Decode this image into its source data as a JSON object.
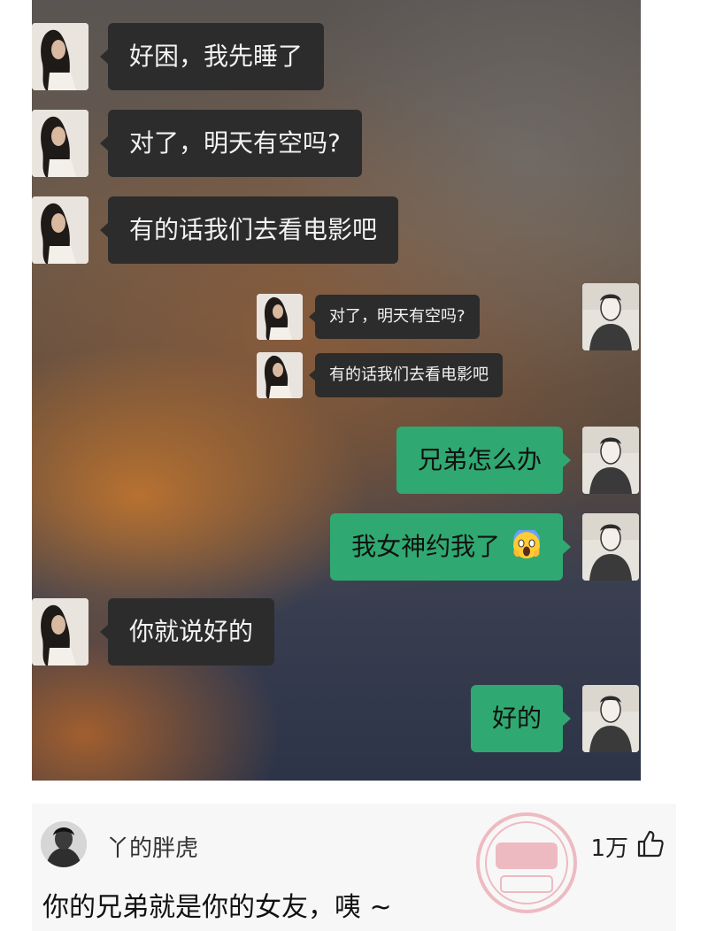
{
  "chat": {
    "messages": [
      {
        "id": "m1",
        "side": "left",
        "size": "big",
        "text": "好困，我先睡了"
      },
      {
        "id": "m2",
        "side": "left",
        "size": "big",
        "text": "对了，明天有空吗?"
      },
      {
        "id": "m3",
        "side": "left",
        "size": "big",
        "text": "有的话我们去看电影吧"
      },
      {
        "id": "m4",
        "side": "left",
        "size": "small",
        "text": "对了，明天有空吗?"
      },
      {
        "id": "m5",
        "side": "left",
        "size": "small",
        "text": "有的话我们去看电影吧"
      },
      {
        "id": "m6",
        "side": "right",
        "size": "big",
        "text": "兄弟怎么办"
      },
      {
        "id": "m7",
        "side": "right",
        "size": "big",
        "text": "我女神约我了",
        "emoji": "face-screaming-in-fear"
      },
      {
        "id": "m8",
        "side": "left",
        "size": "big",
        "text": "你就说好的"
      },
      {
        "id": "m9",
        "side": "right",
        "size": "big",
        "text": "好的"
      }
    ],
    "colors": {
      "left_bubble": "#2c2c2c",
      "right_bubble": "#2fa971"
    }
  },
  "comment": {
    "username": "丫的胖虎",
    "text": "你的兄弟就是你的女友，咦 ~",
    "likes": "1万",
    "like_icon": "thumbs-up-icon"
  },
  "watermark": {
    "icon": "stamp-logo"
  }
}
